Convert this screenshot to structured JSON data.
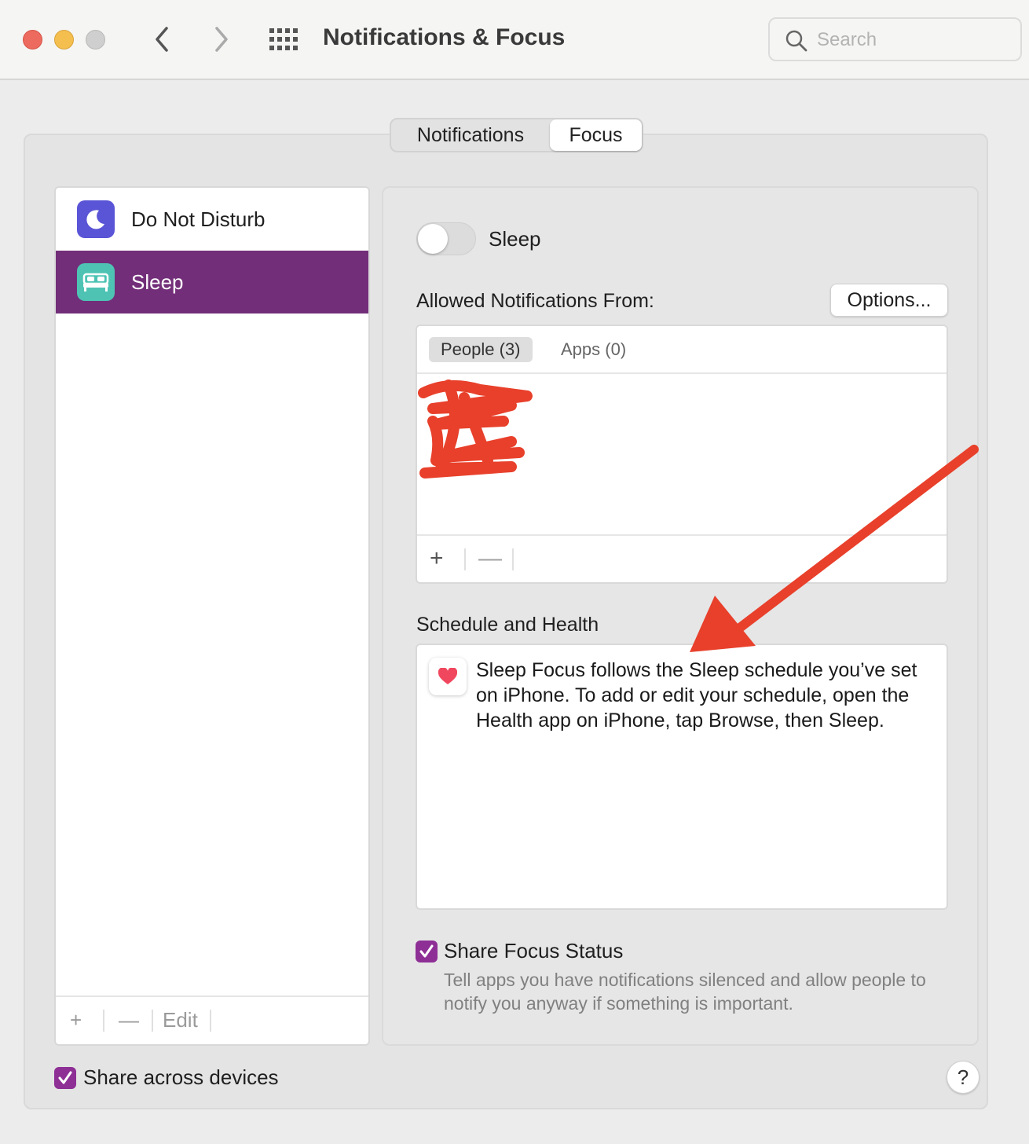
{
  "window": {
    "title": "Notifications & Focus"
  },
  "search": {
    "placeholder": "Search",
    "value": ""
  },
  "tabs": [
    {
      "label": "Notifications",
      "selected": false
    },
    {
      "label": "Focus",
      "selected": true
    }
  ],
  "sidebar": {
    "items": [
      {
        "label": "Do Not Disturb",
        "icon": "moon-icon",
        "icon_color": "#5a54d6",
        "selected": false
      },
      {
        "label": "Sleep",
        "icon": "bed-icon",
        "icon_color": "#4ec3b4",
        "selected": true
      }
    ],
    "footer": {
      "add": "+",
      "remove": "—",
      "edit": "Edit"
    },
    "selected_color": "#722e78"
  },
  "detail": {
    "focus_name": "Sleep",
    "toggle_on": false,
    "allowed_label": "Allowed Notifications From:",
    "options_label": "Options...",
    "allowed_tabs": [
      {
        "label": "People (3)",
        "selected": true
      },
      {
        "label": "Apps (0)",
        "selected": false
      }
    ],
    "allowed_footer": {
      "add": "+",
      "remove": "—"
    },
    "schedule_label": "Schedule and Health",
    "schedule_text": "Sleep Focus follows the Sleep schedule you’ve set on iPhone. To add or edit your schedule, open the Health app on iPhone, tap Browse, then Sleep.",
    "share_focus_label": "Share Focus Status",
    "share_focus_checked": true,
    "share_focus_desc": "Tell apps you have notifications silenced and allow people to notify you anyway if something is important."
  },
  "share_devices": {
    "label": "Share across devices",
    "checked": true
  },
  "help": {
    "label": "?"
  },
  "colors": {
    "accent": "#8e2f96",
    "annotation": "#e8402b"
  }
}
